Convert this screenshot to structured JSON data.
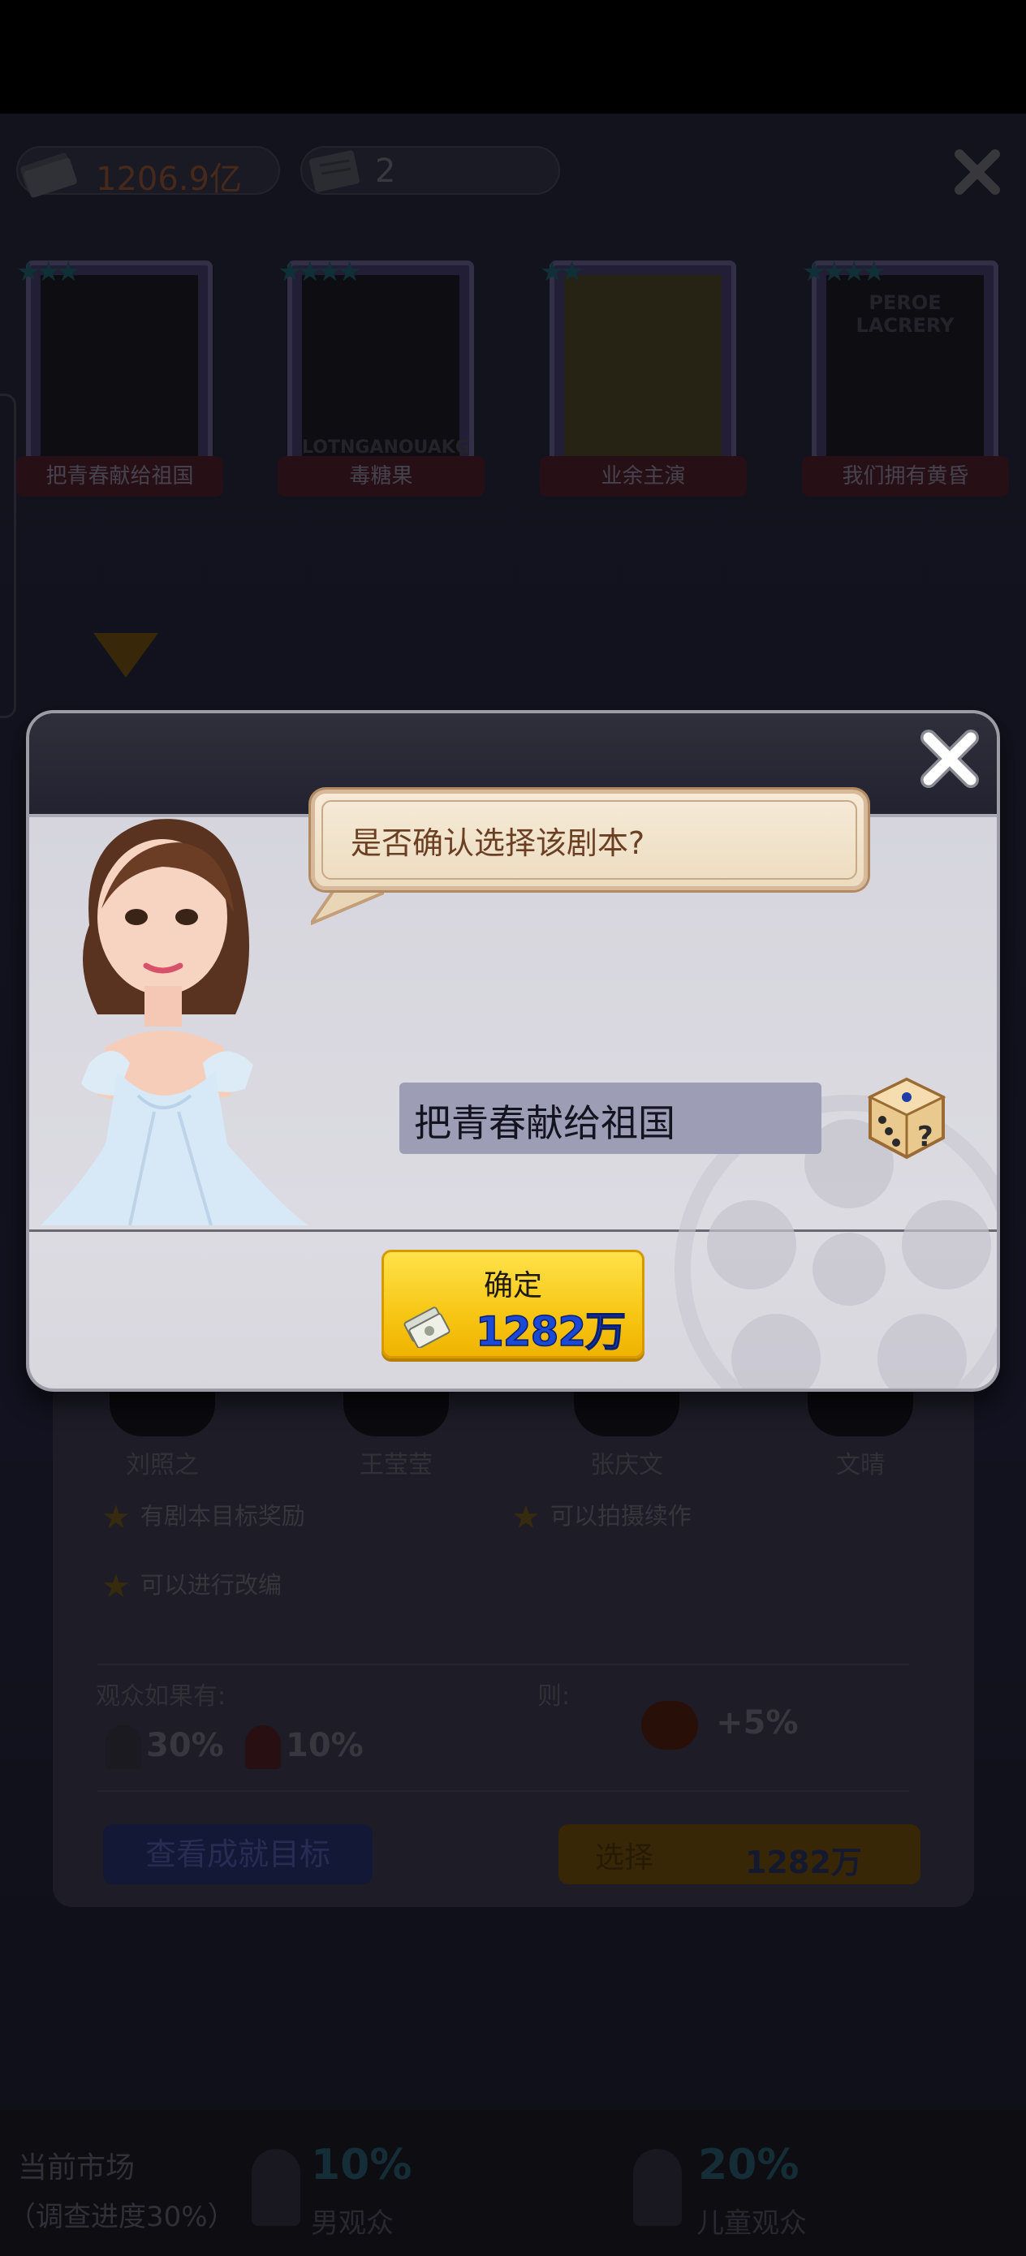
{
  "topbar": {
    "money": "1206.9亿",
    "scripts": "2"
  },
  "posters": [
    {
      "title": "把青春献给祖国",
      "stars": 3
    },
    {
      "title": "毒糖果",
      "stars": 4,
      "poster_text": "LOTNGANOUAKG"
    },
    {
      "title": "业余主演",
      "stars": 2
    },
    {
      "title": "我们拥有黄昏",
      "stars": 4,
      "poster_text": "PEROE LACRERY"
    }
  ],
  "actors": [
    "刘照之",
    "王莹莹",
    "张庆文",
    "文晴"
  ],
  "perks": [
    "有剧本目标奖励",
    "可以拍摄续作",
    "可以进行改编"
  ],
  "audience": {
    "label_if": "观众如果有:",
    "label_then": "则:",
    "male_pct": "30%",
    "female_pct": "10%",
    "bonus": "+5%"
  },
  "buttons": {
    "achievements": "查看成就目标",
    "select": "选择",
    "select_price": "1282万"
  },
  "market": {
    "title": "当前市场",
    "progress": "（调查进度30%）",
    "male_pct": "10%",
    "male_label": "男观众",
    "child_pct": "20%",
    "child_label": "儿童观众"
  },
  "dialog": {
    "question": "是否确认选择该剧本?",
    "script_name": "把青春献给祖国",
    "confirm_label": "确定",
    "confirm_price": "1282万"
  },
  "colors": {
    "confirm_button": "#f7c614",
    "price_text": "#1a49d6",
    "bubble_text": "#6b3f22",
    "script_box": "#9d9db5"
  },
  "icons": [
    "money-icon",
    "script-icon",
    "close-icon",
    "dice-icon",
    "star-icon"
  ]
}
